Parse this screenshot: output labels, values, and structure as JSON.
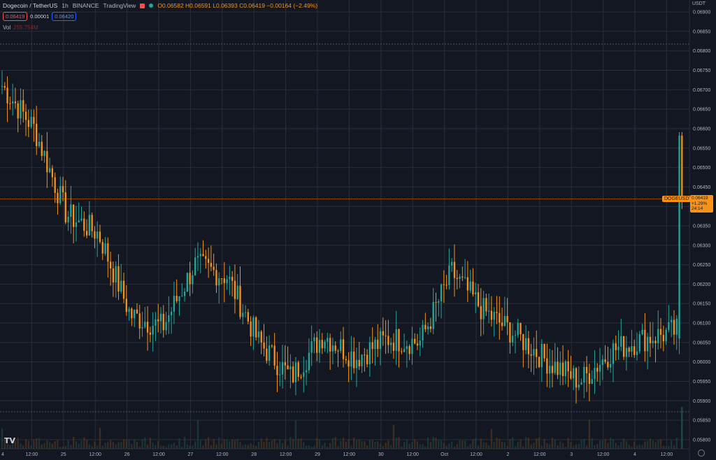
{
  "header": {
    "symbol_title": "Dogecoin / TetherUS",
    "interval": "1h",
    "exchange": "BINANCE",
    "provider": "TradingView",
    "ohlc": "O0.06582 H0.06591 L0.06393 C0.06419 −0.00164 (−2.49%)",
    "sell_price": "0.06419",
    "spread": "0.00001",
    "buy_price": "0.06420",
    "volume_label": "Vol",
    "volume_value": "255.754M"
  },
  "axis": {
    "currency": "USDT",
    "y_ticks": [
      "0.06900",
      "0.06850",
      "0.06800",
      "0.06750",
      "0.06700",
      "0.06650",
      "0.06600",
      "0.06550",
      "0.06500",
      "0.06450",
      "0.06400",
      "0.06350",
      "0.06300",
      "0.06250",
      "0.06200",
      "0.06150",
      "0.06100",
      "0.06050",
      "0.06000",
      "0.05950",
      "0.05900",
      "0.05850",
      "0.05800"
    ],
    "x_ticks": [
      "4",
      "12:00",
      "25",
      "12:00",
      "26",
      "12:00",
      "27",
      "12:00",
      "28",
      "12:00",
      "29",
      "12:00",
      "30",
      "12:00",
      "Oct",
      "12:00",
      "2",
      "12:00",
      "3",
      "12:00",
      "4",
      "12:00"
    ]
  },
  "current_price": {
    "symbol": "DOGEUSDT",
    "price": "0.06419",
    "change": "+1.29%",
    "countdown": "24:14"
  },
  "logo": "TV",
  "colors": {
    "background": "#131722",
    "up": "#26a69a",
    "down": "#f7931a",
    "grid": "#2a2e39",
    "price_line": "#f7931a"
  },
  "chart_data": {
    "type": "candlestick",
    "title": "Dogecoin / TetherUS",
    "ylim": [
      0.0578,
      0.0692
    ],
    "grid": true,
    "key_points": [
      {
        "x": "24 Sep",
        "y": 0.0671
      },
      {
        "x": "24 Sep 12:00",
        "y": 0.066
      },
      {
        "x": "25 Sep",
        "y": 0.0638
      },
      {
        "x": "25 Sep 12:00",
        "y": 0.0633
      },
      {
        "x": "26 Sep",
        "y": 0.0612
      },
      {
        "x": "26 Sep 12:00",
        "y": 0.0609
      },
      {
        "x": "27 Sep",
        "y": 0.0625
      },
      {
        "x": "27 Sep 12:00",
        "y": 0.0622
      },
      {
        "x": "28 Sep",
        "y": 0.0605
      },
      {
        "x": "28 Sep 12:00",
        "y": 0.0596
      },
      {
        "x": "29 Sep",
        "y": 0.0607
      },
      {
        "x": "29 Sep 12:00",
        "y": 0.0601
      },
      {
        "x": "30 Sep",
        "y": 0.0606
      },
      {
        "x": "30 Sep 12:00",
        "y": 0.0605
      },
      {
        "x": "1 Oct",
        "y": 0.0623
      },
      {
        "x": "1 Oct 12:00",
        "y": 0.0613
      },
      {
        "x": "2 Oct",
        "y": 0.0607
      },
      {
        "x": "2 Oct 12:00",
        "y": 0.06
      },
      {
        "x": "3 Oct",
        "y": 0.0595
      },
      {
        "x": "3 Oct 12:00",
        "y": 0.0603
      },
      {
        "x": "4 Oct",
        "y": 0.0606
      },
      {
        "x": "4 Oct 12:00",
        "y": 0.0608
      },
      {
        "x": "4 Oct 15:00",
        "y": 0.06582
      }
    ],
    "last": {
      "open": 0.06582,
      "high": 0.06591,
      "low": 0.06393,
      "close": 0.06419
    }
  }
}
